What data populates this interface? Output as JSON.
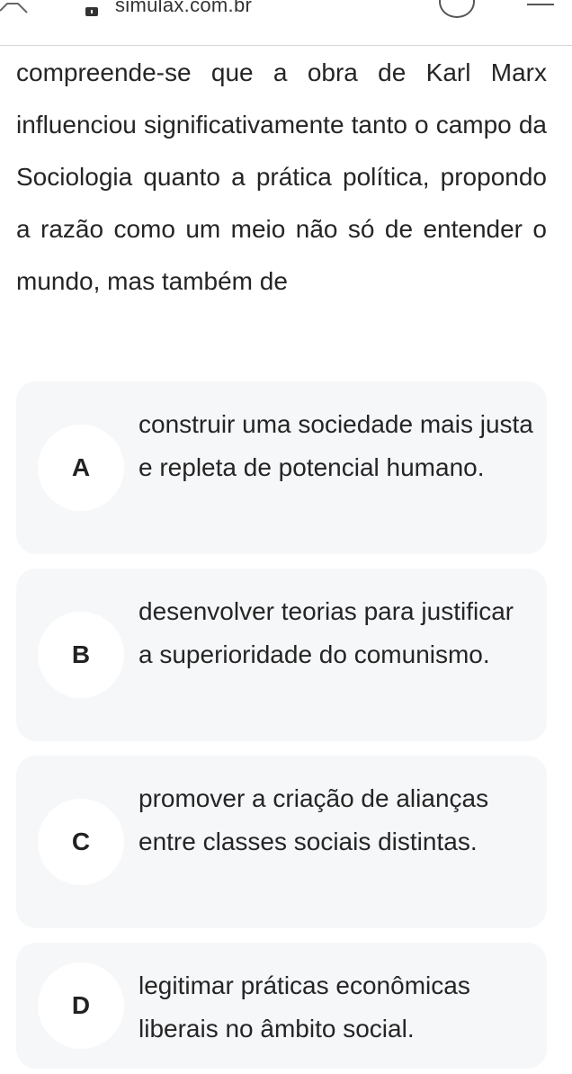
{
  "browser": {
    "url": "simulax.com.br"
  },
  "question": {
    "text": "compreende-se que a obra de Karl Marx influenciou significativamente tanto o campo da Sociologia quanto a prática política, propondo a razão como um meio não só de entender o mundo, mas também de"
  },
  "options": [
    {
      "letter": "A",
      "text": "construir uma sociedade mais justa e repleta de potencial humano."
    },
    {
      "letter": "B",
      "text": "desenvolver teorias para justificar a superioridade do comunismo."
    },
    {
      "letter": "C",
      "text": "promover a criação de alianças entre classes sociais distintas."
    },
    {
      "letter": "D",
      "text": "legitimar práticas econômicas liberais no âmbito social."
    }
  ]
}
